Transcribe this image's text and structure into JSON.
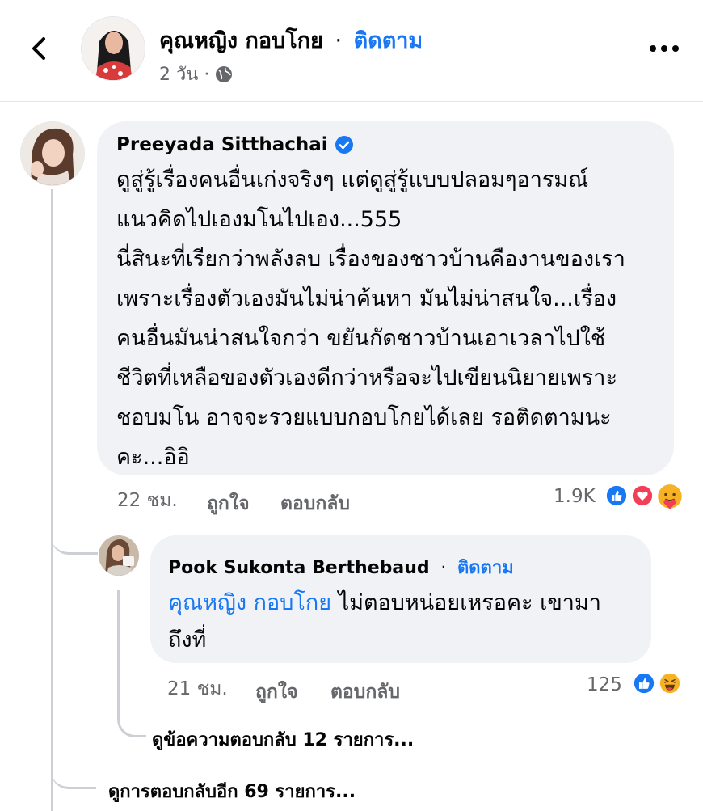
{
  "header": {
    "page_name": "คุณหญิง กอบโกย",
    "separator": "·",
    "follow_label": "ติดตาม",
    "time": "2 วัน ·",
    "privacy_icon": "globe-icon"
  },
  "comment": {
    "author": "Preeyada Sitthachai",
    "verified": true,
    "text": "ดูสู่รู้เรื่องคนอื่นเก่งจริงๆ แต่ดูสู่รู้แบบปลอมๆอารมณ์\nแนวคิดไปเองมโนไปเอง...555\nนี่สินะที่เรียกว่าพลังลบ เรื่องของชาวบ้านคืองานของเรา\nเพราะเรื่องตัวเองมันไม่น่าค้นหา มันไม่น่าสนใจ...เรื่อง\nคนอื่นมันน่าสนใจกว่า ขยันกัดชาวบ้านเอาเวลาไปใช้\nชีวิตที่เหลือของตัวเองดีกว่าหรือจะไปเขียนนิยายเพราะ\nชอบมโน อาจจะรวยแบบกอบโกยได้เลย รอติดตามนะ\nคะ...อิอิ",
    "time": "22 ชม.",
    "like_label": "ถูกใจ",
    "reply_label": "ตอบกลับ",
    "reaction_count": "1.9K",
    "reactions": [
      "like-icon",
      "love-icon",
      "care-icon"
    ]
  },
  "reply": {
    "author": "Pook Sukonta Berthebaud",
    "separator": "·",
    "follow_label": "ติดตาม",
    "mention": "คุณหญิง กอบโกย",
    "text": " ไม่ตอบหน่อยเหรอคะ เขามา\nถึงที่",
    "time": "21 ชม.",
    "like_label": "ถูกใจ",
    "reply_label": "ตอบกลับ",
    "reaction_count": "125",
    "reactions": [
      "like-icon",
      "haha-icon"
    ],
    "view_replies": "ดูข้อความตอบกลับ 12 รายการ..."
  },
  "more_replies": "ดูการตอบกลับอีก 69 รายการ...",
  "colors": {
    "link": "#1877f2",
    "bubble": "#f0f2f5",
    "muted": "#65676b"
  }
}
